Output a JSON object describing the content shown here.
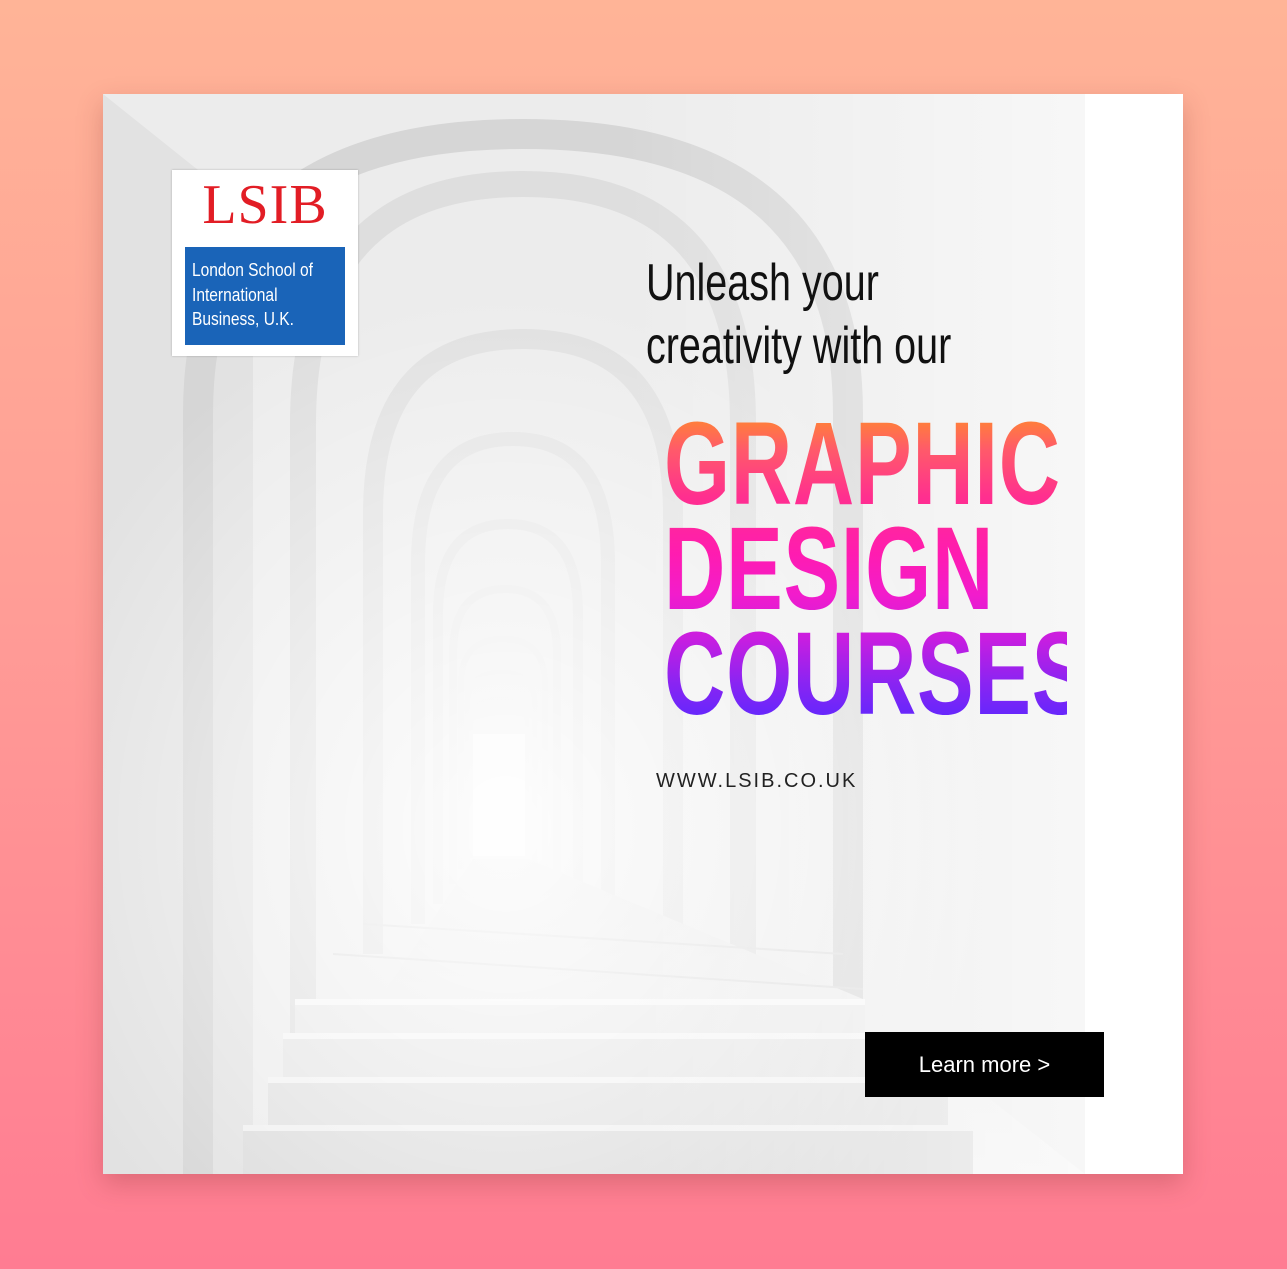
{
  "logo": {
    "wordmark": "LSIB",
    "lines": [
      "London School of",
      "International",
      "Business, U.K."
    ],
    "colors": {
      "wordmark": "#e21d25",
      "box": "#1a64b8"
    }
  },
  "headline": {
    "tagline_lines": [
      "Unleash your",
      "creativity with our"
    ],
    "main_lines": [
      "GRAPHIC",
      "DESIGN",
      "COURSES!"
    ],
    "gradient_colors": [
      "#ff8a2c",
      "#ff2f8f",
      "#f21ccc",
      "#5a28ff"
    ]
  },
  "website": "WWW.LSIB.CO.UK",
  "cta": {
    "label": "Learn more >"
  },
  "colors": {
    "background_top": "#ffb497",
    "background_bottom": "#ff7c92",
    "cta_bg": "#000000"
  }
}
